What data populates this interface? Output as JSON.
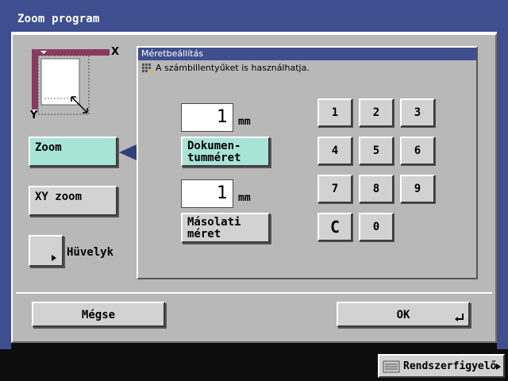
{
  "window": {
    "title": "Zoom program"
  },
  "left": {
    "zoom_label": "Zoom",
    "xy_zoom_label": "XY zoom",
    "inch_label": "Hüvelyk",
    "diagram_x": "X",
    "diagram_y": "Y"
  },
  "panel": {
    "header": "Méretbeállítás",
    "hint": "A számbillentyűket is használhatja.",
    "document_size": {
      "value": "1",
      "unit": "mm",
      "button_line1": "Dokumen-",
      "button_line2": "tumméret"
    },
    "copy_size": {
      "value": "1",
      "unit": "mm",
      "button_line1": "Másolati",
      "button_line2": "méret"
    },
    "keypad": [
      "1",
      "2",
      "3",
      "4",
      "5",
      "6",
      "7",
      "8",
      "9",
      "C",
      "0"
    ]
  },
  "footer": {
    "cancel_label": "Mégse",
    "ok_label": "OK"
  },
  "system": {
    "label": "Rendszerfigyelő"
  },
  "colors": {
    "titlebar": "#3e4e8e",
    "dialog_bg": "#b8b8b8",
    "selected_button": "#a8e4d6",
    "button_bg": "#d2d2d2"
  }
}
